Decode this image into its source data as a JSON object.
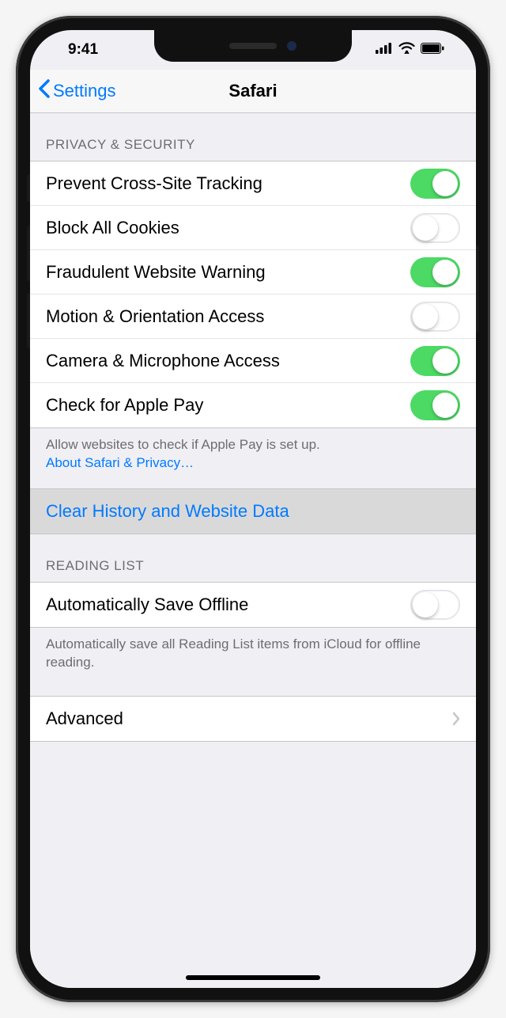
{
  "status": {
    "time": "9:41"
  },
  "nav": {
    "back_label": "Settings",
    "title": "Safari"
  },
  "sections": {
    "privacy": {
      "header": "PRIVACY & SECURITY",
      "rows": [
        {
          "label": "Prevent Cross-Site Tracking",
          "on": true
        },
        {
          "label": "Block All Cookies",
          "on": false
        },
        {
          "label": "Fraudulent Website Warning",
          "on": true
        },
        {
          "label": "Motion & Orientation Access",
          "on": false
        },
        {
          "label": "Camera & Microphone Access",
          "on": true
        },
        {
          "label": "Check for Apple Pay",
          "on": true
        }
      ],
      "footer_text": "Allow websites to check if Apple Pay is set up.",
      "footer_link": "About Safari & Privacy…"
    },
    "clear_action": {
      "label": "Clear History and Website Data"
    },
    "reading_list": {
      "header": "READING LIST",
      "rows": [
        {
          "label": "Automatically Save Offline",
          "on": false
        }
      ],
      "footer_text": "Automatically save all Reading List items from iCloud for offline reading."
    },
    "advanced": {
      "label": "Advanced"
    }
  }
}
